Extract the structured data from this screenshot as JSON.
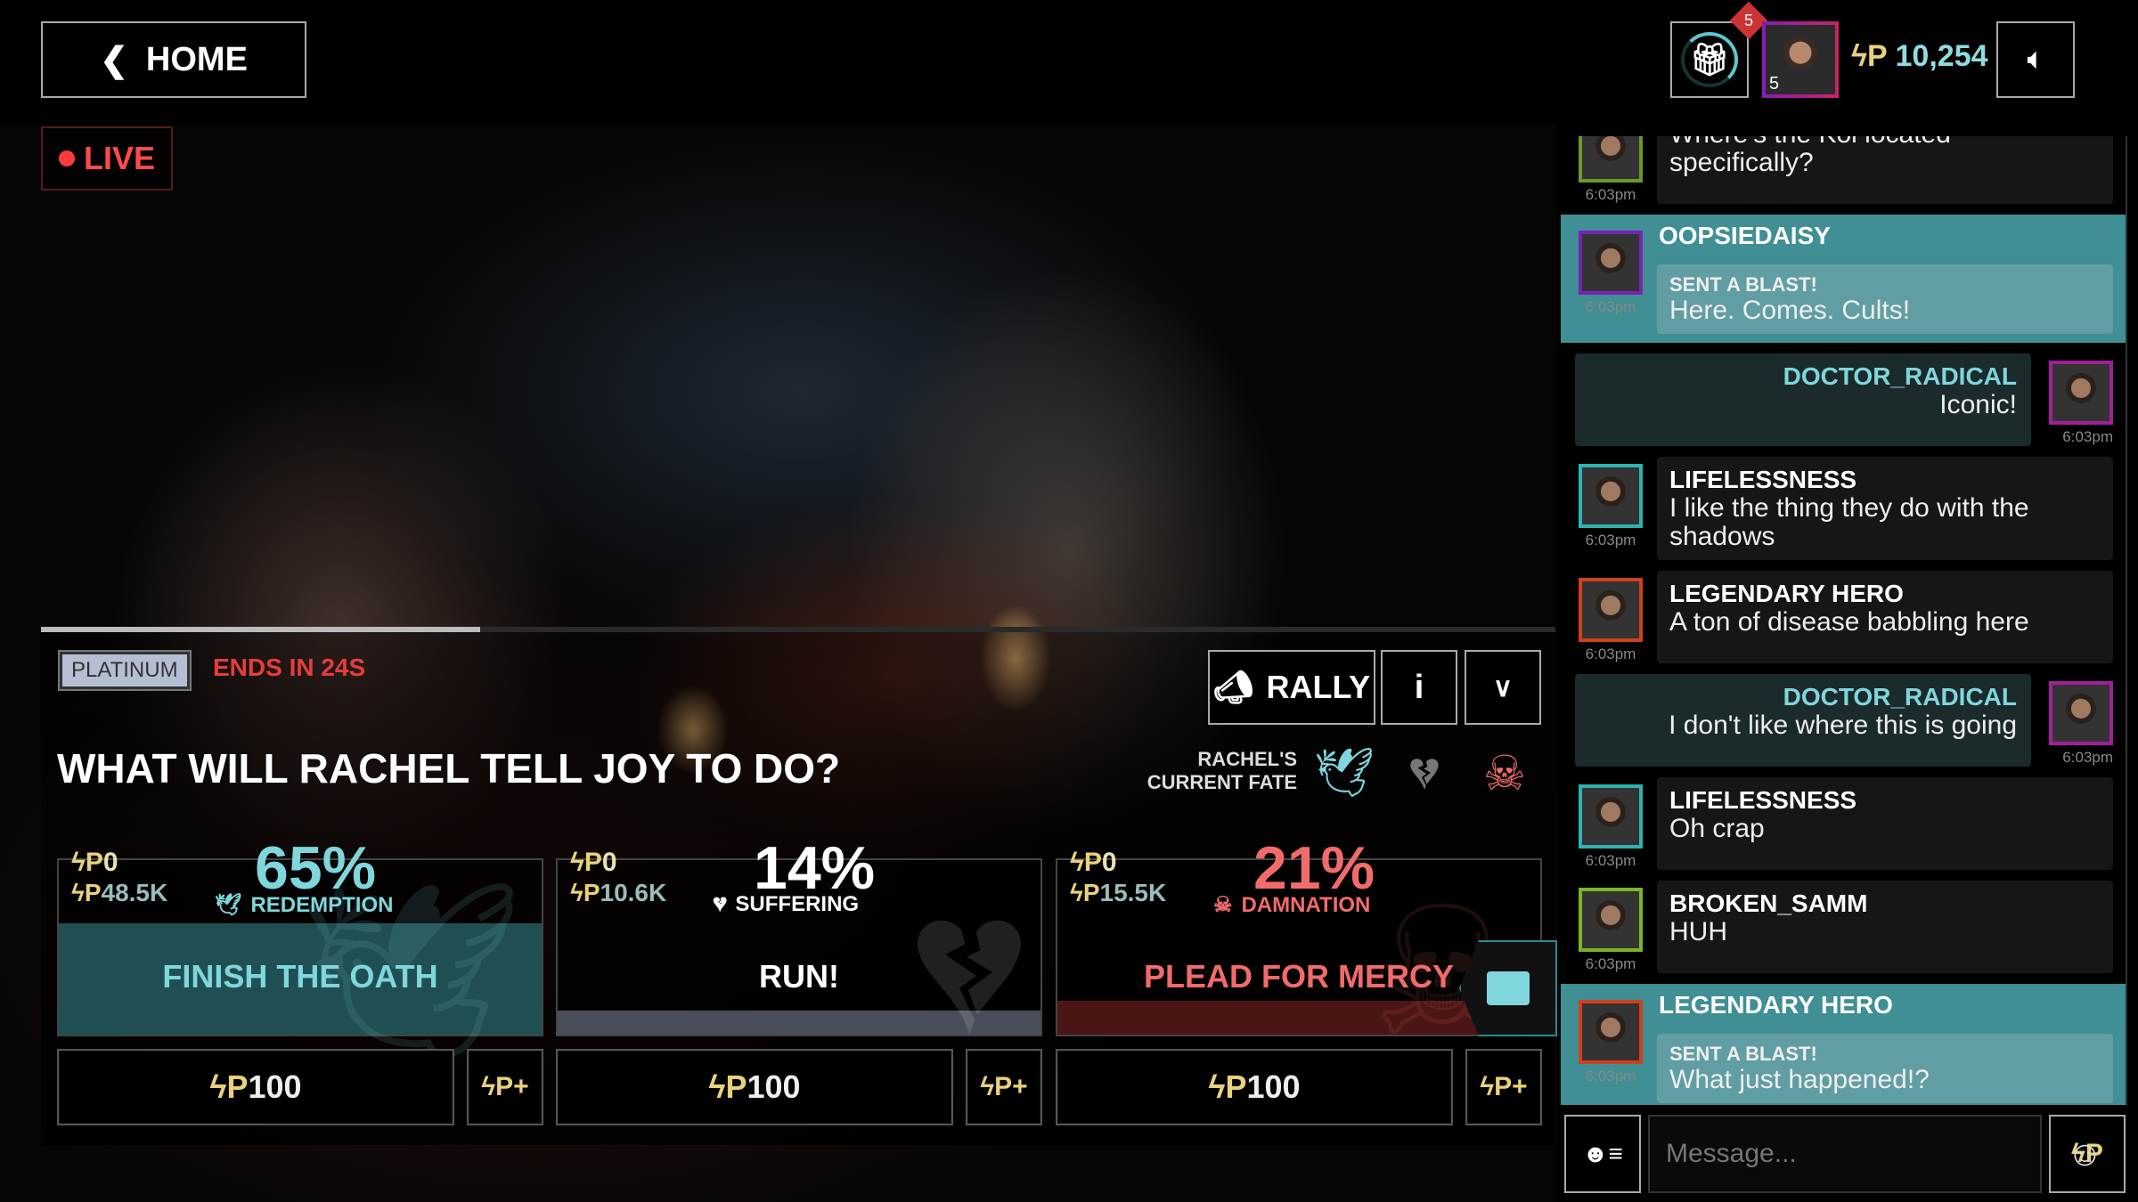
{
  "header": {
    "home_label": "HOME",
    "live_label": "LIVE",
    "notifications": "5",
    "level": "5",
    "balance": "10,254"
  },
  "icons": {
    "back": "chevron-left-icon",
    "gift": "gift-icon",
    "volume": "speaker-icon",
    "coin": "coin-icon",
    "megaphone": "megaphone-icon",
    "info": "info-icon",
    "chevron": "chevron-down-icon",
    "dove": "dove-icon",
    "broken_heart": "broken-heart-icon",
    "skull": "skull-icon",
    "chat": "chat-bubble-icon",
    "roster": "user-list-icon",
    "emoji": "emoji-icon"
  },
  "poll": {
    "timer_progress": 0.29,
    "tier": "PLATINUM",
    "ends": "ENDS IN 24S",
    "rally_label": "RALLY",
    "question": "WHAT WILL RACHEL TELL JOY TO DO?",
    "fate_label": "RACHEL'S CURRENT FATE",
    "options": [
      {
        "my_bet": "0",
        "pool": "48.5K",
        "percent": "65%",
        "fate": "REDEMPTION",
        "title": "FINISH THE OATH",
        "color": "#7fd6dc",
        "fill": "#1f4f52",
        "bet": "100"
      },
      {
        "my_bet": "0",
        "pool": "10.6K",
        "percent": "14%",
        "fate": "SUFFERING",
        "title": "RUN!",
        "color": "#ffffff",
        "fill": "#4a4e58",
        "bet": "100"
      },
      {
        "my_bet": "0",
        "pool": "15.5K",
        "percent": "21%",
        "fate": "DAMNATION",
        "title": "PLEAD FOR MERCY",
        "color": "#f26b6b",
        "fill": "#4a1515",
        "bet": "100"
      }
    ]
  },
  "chat": {
    "placeholder": "Message...",
    "messages": [
      {
        "user": "",
        "text": "Where's the Koi located specifically?",
        "time": "6:03pm",
        "border": "#6a9a2a"
      },
      {
        "user": "OOPSIEDAISY",
        "blast": "SENT A BLAST!",
        "text": "Here. Comes. Cults!",
        "time": "6:03pm",
        "border": "#7a22b3"
      },
      {
        "user": "DOCTOR_RADICAL",
        "text": "Iconic!",
        "time": "6:03pm",
        "border": "#a21f9a",
        "self": true
      },
      {
        "user": "LIFELESSNESS",
        "text": "I like the thing they do with the shadows",
        "time": "6:03pm",
        "border": "#2fb3b0"
      },
      {
        "user": "LEGENDARY HERO",
        "text": "A ton of disease babbling here",
        "time": "6:03pm",
        "border": "#d0401f"
      },
      {
        "user": "DOCTOR_RADICAL",
        "text": "I don't like where this is going",
        "time": "6:03pm",
        "border": "#a21f9a",
        "self": true
      },
      {
        "user": "LIFELESSNESS",
        "text": "Oh crap",
        "time": "6:03pm",
        "border": "#2fb3b0"
      },
      {
        "user": "BROKEN_SAMM",
        "text": "HUH",
        "time": "6:03pm",
        "border": "#7cb32a"
      },
      {
        "user": "LEGENDARY HERO",
        "blast": "SENT A BLAST!",
        "text": "What just happened!?",
        "time": "6:03pm",
        "border": "#d0401f"
      }
    ]
  }
}
